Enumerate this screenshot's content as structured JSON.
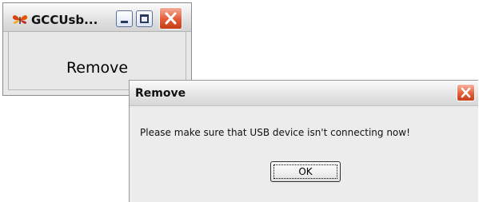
{
  "main_window": {
    "title": "GCCUsb...",
    "label": "Remove",
    "icons": {
      "app": "butterfly-app-icon",
      "minimize": "minimize-icon",
      "maximize": "maximize-icon",
      "close": "close-icon"
    }
  },
  "dialog": {
    "title": "Remove",
    "message": "Please make sure that USB device isn't connecting now!",
    "ok_label": "OK",
    "icons": {
      "close": "close-icon"
    }
  },
  "colors": {
    "close_button": "#e15b35",
    "titlebar_light": "#fbfbfb",
    "titlebar_dark": "#d3d3d3",
    "window_bg": "#e8e8e8"
  }
}
